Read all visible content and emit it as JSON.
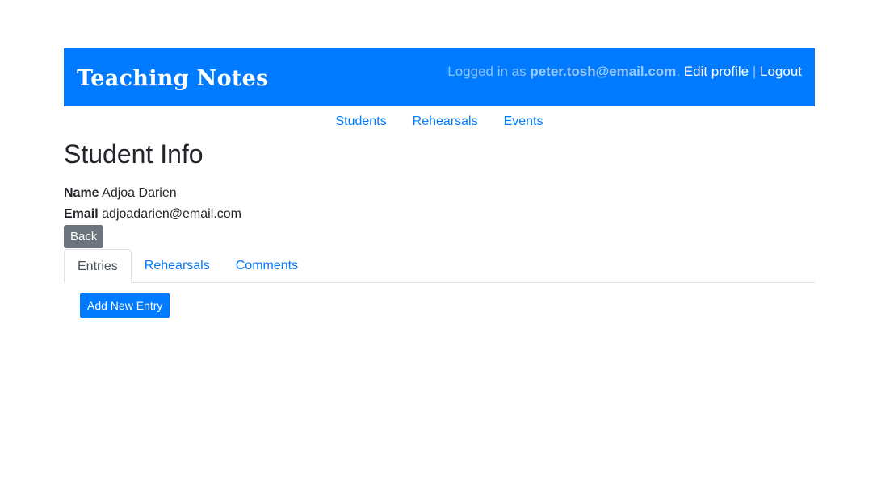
{
  "header": {
    "brand": "Teaching Notes",
    "logged_in_prefix": "Logged in as ",
    "user_email": "peter.tosh@email.com",
    "period": ".",
    "edit_profile": "Edit profile",
    "separator": "|",
    "logout": "Logout"
  },
  "nav": {
    "students": "Students",
    "rehearsals": "Rehearsals",
    "events": "Events"
  },
  "page": {
    "title": "Student Info"
  },
  "student": {
    "name_label": "Name",
    "name_value": "Adjoa Darien",
    "email_label": "Email",
    "email_value": "adjoadarien@email.com"
  },
  "actions": {
    "back": "Back",
    "add_entry": "Add New Entry"
  },
  "tabs": {
    "entries": "Entries",
    "rehearsals": "Rehearsals",
    "comments": "Comments"
  },
  "colors": {
    "primary": "#007bff",
    "secondary": "#6c757d"
  }
}
